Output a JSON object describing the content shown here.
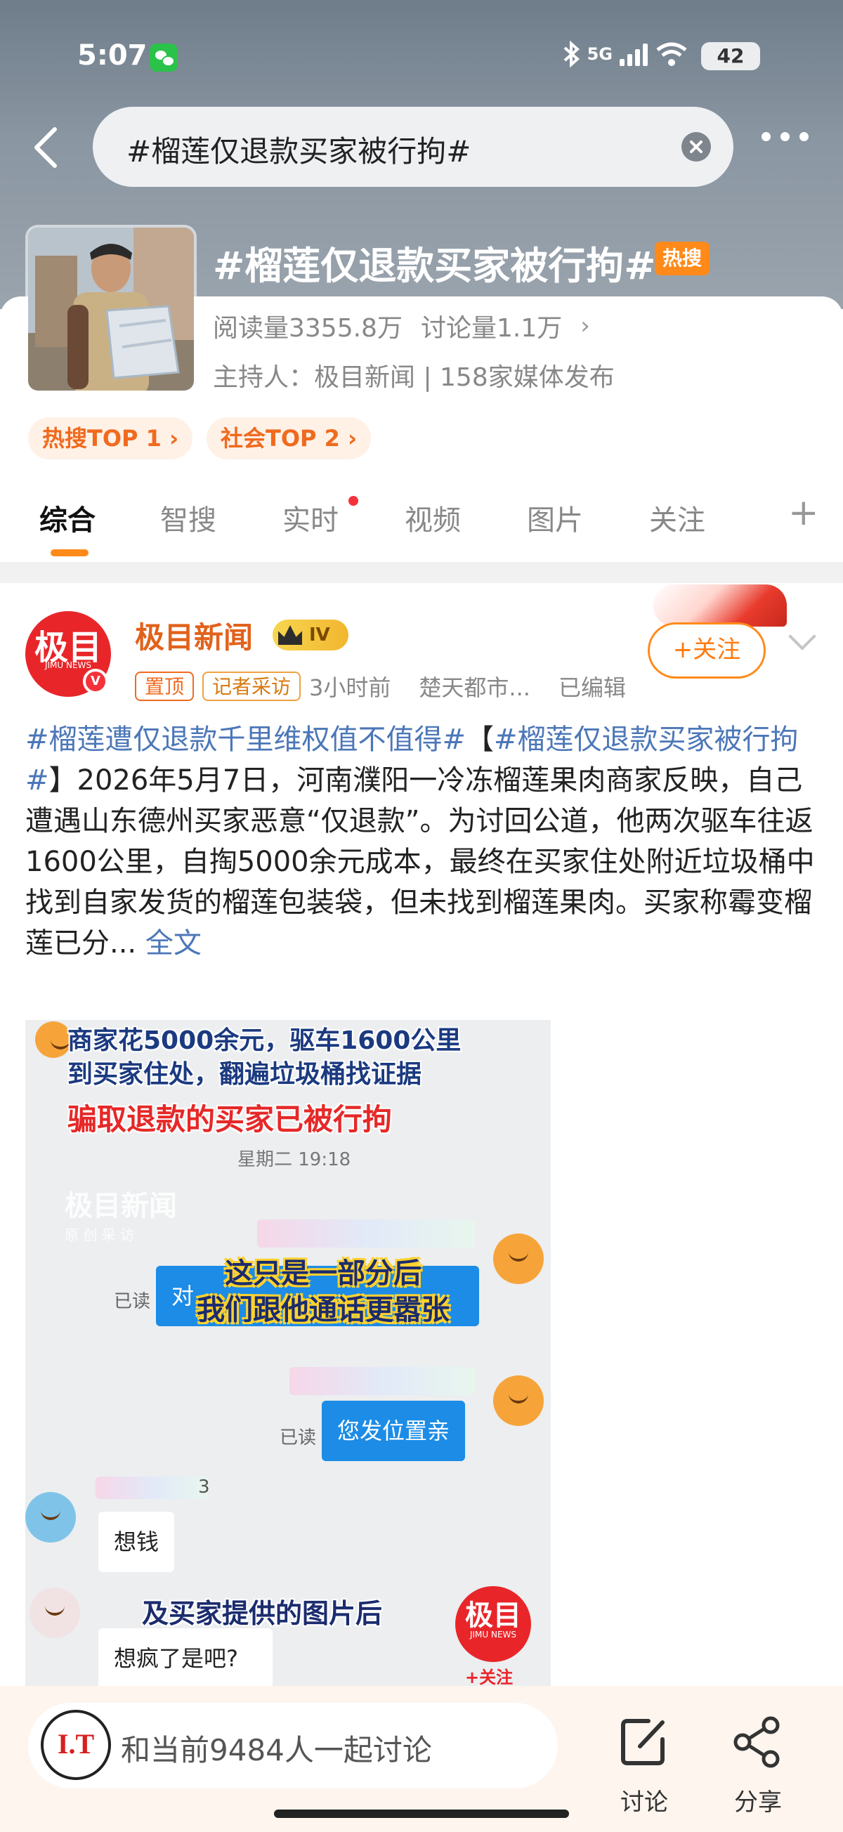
{
  "status": {
    "time": "5:07",
    "network": "5G",
    "battery": "42"
  },
  "search": {
    "query": "#榴莲仅退款买家被行拘#"
  },
  "topic": {
    "title": "#榴莲仅退款买家被行拘#",
    "hot_badge": "热搜",
    "reads": "阅读量3355.8万",
    "discussions": "讨论量1.1万",
    "host": "主持人：极目新闻 | 158家媒体发布",
    "rank_tags": [
      "热搜TOP 1 ›",
      "社会TOP 2 ›"
    ]
  },
  "tabs": [
    "综合",
    "智搜",
    "实时",
    "视频",
    "图片",
    "关注"
  ],
  "post": {
    "avatar_text": "极目",
    "avatar_sub": "JIMU NEWS",
    "verify": "V",
    "author": "极目新闻",
    "level": "IV",
    "pin_chip": "置顶",
    "reporter_chip": "记者采访",
    "time": "3小时前",
    "source": "楚天都市...",
    "edited": "已编辑",
    "follow_label": "+关注",
    "text_hashtag1": "#榴莲遭仅退款千里维权值不值得#",
    "text_bracket_open": "【",
    "text_hashtag2": "#榴莲仅退款买家被行拘#",
    "text_body": "】2026年5月7日，河南濮阳一冷冻榴莲果肉商家反映，自己遭遇山东德州买家恶意“仅退款”。为讨回公道，他两次驱车往返1600公里，自掏5000余元成本，最终在买家住处附近垃圾桶中找到自家发货的榴莲包装袋，但未找到榴莲果肉。买家称霉变榴莲已分...",
    "full_text_link": "全文"
  },
  "video": {
    "caption_line1": "商家花5000余元，驱车1600公里",
    "caption_line2": "到买家住处，翻遍垃圾桶找证据",
    "caption_red": "骗取退款的买家已被行拘",
    "chat_time": "星期二 19:18",
    "watermark": "极目新闻",
    "watermark_sub": "原 创 采 访",
    "subtitle_a1": "这只是一部分后",
    "subtitle_a2": "我们跟他通话更嚣张",
    "bubble1_partial": "对",
    "read_label": "已读",
    "bubble2": "您发位置亲",
    "partial_num": "3",
    "bubble3": "想钱",
    "subtitle_b": "及买家提供的图片后",
    "bubble4": "想疯了是吧?",
    "logo_text": "极目",
    "logo_sub": "JIMU NEWS",
    "logo_follow": "+关注"
  },
  "bottom_bar": {
    "logo_text": "I.T",
    "discuss_placeholder": "和当前9484人一起讨论",
    "discuss_label": "讨论",
    "share_label": "分享"
  },
  "colors": {
    "accent": "#ff8a1a",
    "brand_red": "#e8262a",
    "link_blue": "#4c77b8"
  }
}
